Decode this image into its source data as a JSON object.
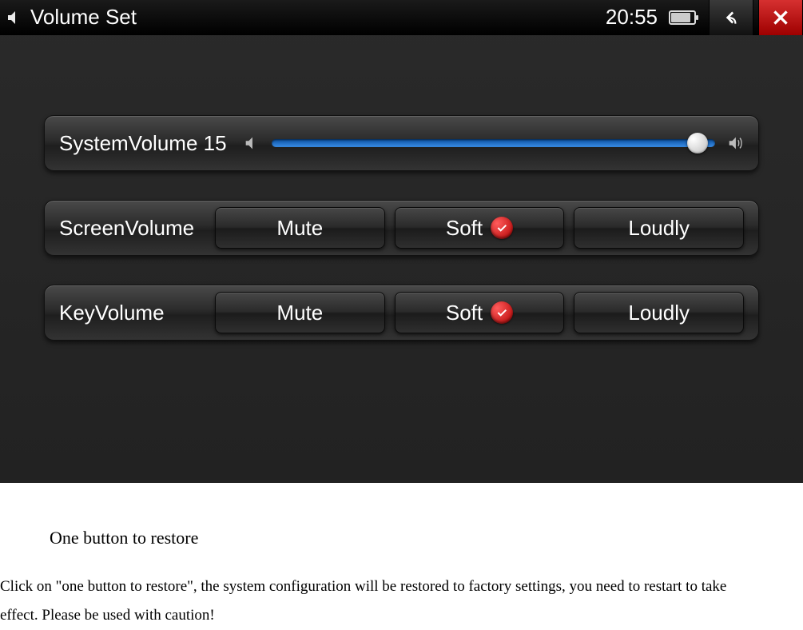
{
  "titlebar": {
    "title": "Volume Set",
    "clock": "20:55"
  },
  "system_volume": {
    "label": "SystemVolume 15",
    "value": 15,
    "max": 15
  },
  "screen_volume": {
    "label": "ScreenVolume",
    "options": {
      "mute": "Mute",
      "soft": "Soft",
      "loudly": "Loudly"
    },
    "selected": "soft"
  },
  "key_volume": {
    "label": "KeyVolume",
    "options": {
      "mute": "Mute",
      "soft": "Soft",
      "loudly": "Loudly"
    },
    "selected": "soft"
  },
  "doc": {
    "heading": "One button to restore",
    "body": "Click on \"one button to restore\", the system configuration will be restored to factory settings, you need to restart to take effect. Please be used with caution!"
  }
}
